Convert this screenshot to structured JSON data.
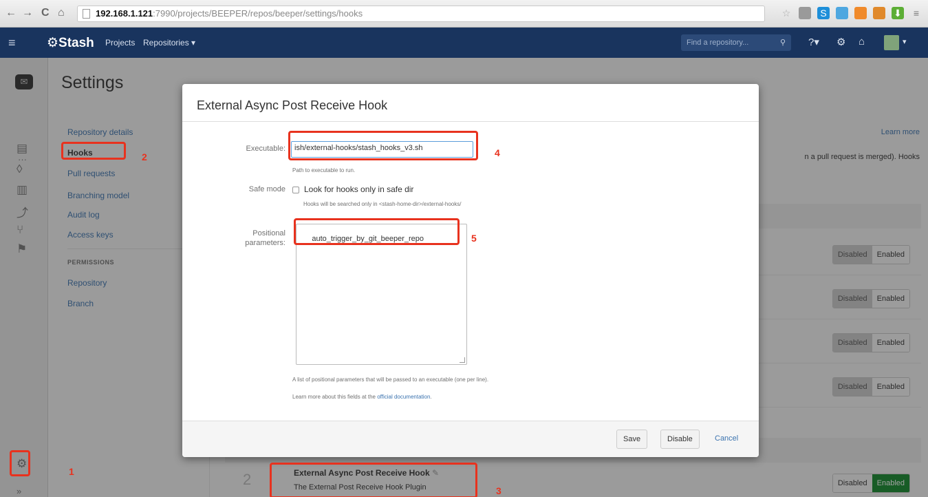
{
  "browser": {
    "back_glyph": "←",
    "forward_glyph": "→",
    "reload_glyph": "C",
    "home_glyph": "⌂",
    "url_host": "192.168.1.121",
    "url_rest": ":7990/projects/BEEPER/repos/beeper/settings/hooks",
    "extensions": [
      {
        "name": "star-icon",
        "glyph": "☆",
        "color": "#aaaaaa"
      },
      {
        "name": "extension-icon-1",
        "glyph": "",
        "color": "#9a9a9a"
      },
      {
        "name": "skype-icon",
        "glyph": "S",
        "color": "#1e8fd9"
      },
      {
        "name": "extension-icon-2",
        "glyph": "",
        "color": "#4ea7e0"
      },
      {
        "name": "extension-icon-3",
        "glyph": "",
        "color": "#f08a2b"
      },
      {
        "name": "extension-icon-4",
        "glyph": "",
        "color": "#e0892b"
      },
      {
        "name": "download-icon",
        "glyph": "⬇",
        "color": "#5cae35"
      },
      {
        "name": "menu-icon",
        "glyph": "≡",
        "color": "#777777"
      }
    ]
  },
  "header": {
    "logo": "Stash",
    "logo_glyph": "⚙",
    "menu_glyph": "≡",
    "nav_projects": "Projects",
    "nav_repositories": "Repositories ▾",
    "search_placeholder": "Find a repository...",
    "search_glyph": "⚲",
    "help_glyph": "?▾",
    "settings_glyph": "⚙",
    "inbox_glyph": "⌂"
  },
  "iconbar": {
    "repo_glyph": "✉",
    "more_glyph": "···",
    "source_glyph": "▤",
    "commits_glyph": "◊",
    "graph_glyph": "▥",
    "pr_glyph": "⤴",
    "branch_glyph": "⑂",
    "pulls_badge": "⚑",
    "settings_glyph": "⚙",
    "expand_glyph": "»"
  },
  "settings": {
    "title": "Settings",
    "items": [
      "Repository details",
      "Hooks",
      "Pull requests",
      "Branching model",
      "Audit log",
      "Access keys"
    ],
    "permissions_heading": "PERMISSIONS",
    "permission_items": [
      "Repository",
      "Branch"
    ]
  },
  "main": {
    "learn_more": "Learn more",
    "desc_fragment": "n a pull request is merged). Hooks",
    "toggle_disabled": "Disabled",
    "toggle_enabled": "Enabled",
    "ext_hook_num": "2",
    "ext_hook_title": "External Async Post Receive Hook",
    "ext_hook_edit": "✎",
    "ext_hook_desc": "The External Post Receive Hook Plugin"
  },
  "modal": {
    "title": "External Async Post Receive Hook",
    "executable_label": "Executable:",
    "executable_value": "ish/external-hooks/stash_hooks_v3.sh",
    "executable_hint": "Path to executable to run.",
    "safe_mode_label": "Safe mode",
    "safe_mode_checkbox": "Look for hooks only in safe dir",
    "safe_mode_hint": "Hooks will be searched only in <stash-home-dir>/external-hooks/",
    "positional_label_1": "Positional",
    "positional_label_2": "parameters:",
    "positional_value": "auto_trigger_by_git_beeper_repo",
    "positional_hint": "A list of positional parameters that will be passed to an executable (one per line).",
    "doc_text": "Learn more about this fields at the ",
    "doc_link": "official documentation",
    "doc_end": ".",
    "save": "Save",
    "disable": "Disable",
    "cancel": "Cancel"
  },
  "annotations": [
    "1",
    "2",
    "3",
    "4",
    "5"
  ],
  "colors": {
    "header_bg": "#19345e",
    "link": "#3b73af",
    "annotation": "#e8321e",
    "enabled_green": "#14892c"
  }
}
